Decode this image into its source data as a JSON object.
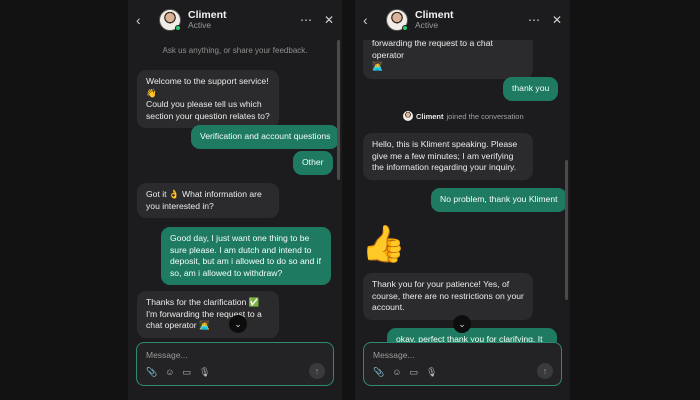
{
  "chat": {
    "agent_name": "Climent",
    "status": "Active",
    "intro_note": "Ask us anything, or share your feedback.",
    "composer_placeholder": "Message...",
    "left_messages": [
      {
        "sender": "bot",
        "text": "Welcome to the support service! 👋\nCould you please tell us which section your question relates to?"
      },
      {
        "sender": "user",
        "text": "Verification and account questions"
      },
      {
        "sender": "user",
        "text": "Other"
      },
      {
        "sender": "bot",
        "text": "Got it 👌 What information are you interested in?"
      },
      {
        "sender": "user",
        "text": "Good day, I just want one thing to be sure please. I am dutch and intend to deposit, but am i allowed to do so and if so, am i allowed to withdraw?"
      },
      {
        "sender": "bot",
        "text": "Thanks for the clarification ✅ I'm forwarding the request to a chat operator 👩‍💻"
      }
    ],
    "right_messages": [
      {
        "sender": "bot",
        "text": "forwarding the request to a chat operator\n👩‍💻"
      },
      {
        "sender": "user",
        "text": "thank you"
      },
      {
        "sender": "bot",
        "text": "Hello, this is Kliment speaking. Please give me a few minutes; I am verifying the information regarding your inquiry."
      },
      {
        "sender": "user",
        "text": "No problem, thank you Kliment"
      },
      {
        "sender": "bot",
        "text": "Thank you for your patience! Yes, of course, there are no restrictions on your account."
      },
      {
        "sender": "user",
        "text": "okay, perfect thank you for clarifying. It is"
      }
    ],
    "joined": {
      "name": "Climent",
      "text": "joined the conversation"
    },
    "thumb_emoji": "👍"
  },
  "icons": {
    "back": "‹",
    "more": "⋯",
    "close": "✕",
    "scroll_down": "⌄",
    "attach": "📎",
    "emoji": "☺",
    "gif": "▭",
    "mic": "🎙",
    "send": "↑"
  },
  "colors": {
    "panel": "#1c1c1e",
    "bot_bubble": "#2b2b2d",
    "user_bubble": "#1f7a62",
    "accent": "#2f8b6f"
  }
}
